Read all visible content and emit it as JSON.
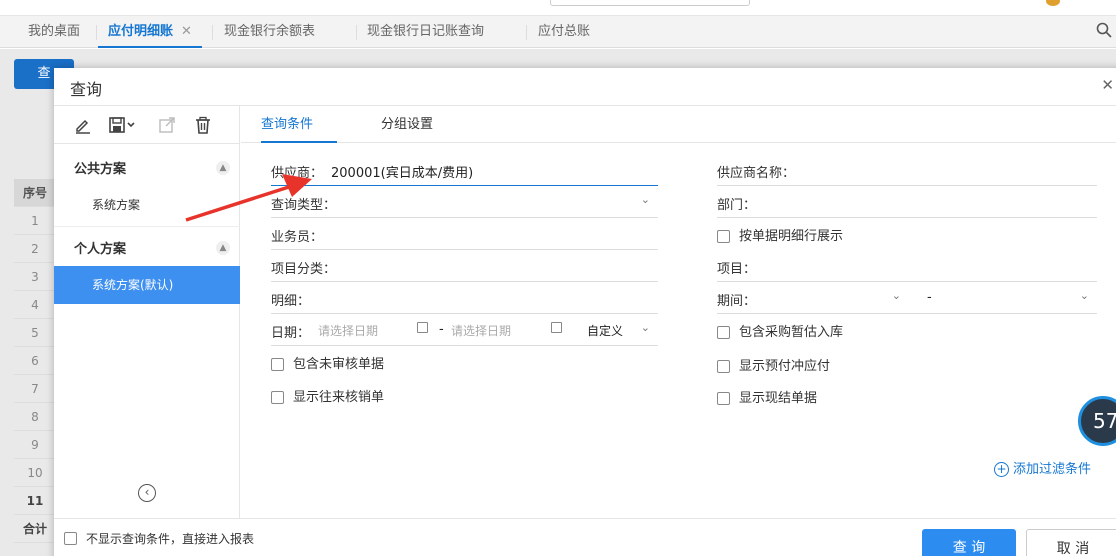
{
  "tabs": [
    {
      "label": "我的桌面"
    },
    {
      "label": "应付明细账",
      "close": "✕"
    },
    {
      "label": "现金银行余额表"
    },
    {
      "label": "现金银行日记账查询"
    },
    {
      "label": "应付总账"
    }
  ],
  "background": {
    "query_button": "查",
    "col_header": "序号",
    "rows": [
      "1",
      "2",
      "3",
      "4",
      "5",
      "6",
      "7",
      "8",
      "9",
      "10",
      "11"
    ],
    "total": "合计"
  },
  "dialog": {
    "title": "查询",
    "close": "✕"
  },
  "left": {
    "public_group": "公共方案",
    "public_item": "系统方案",
    "personal_group": "个人方案",
    "personal_item": "系统方案(默认)"
  },
  "query_tabs": {
    "conditions": "查询条件",
    "grouping": "分组设置"
  },
  "form": {
    "supplier_label": "供应商：",
    "supplier_value": "200001(宾日成本/费用)",
    "query_type_label": "查询类型：",
    "salesman_label": "业务员：",
    "project_category_label": "项目分类：",
    "detail_label": "明细：",
    "date_label": "日期：",
    "date_start_placeholder": "请选择日期",
    "date_sep": "-",
    "date_end_placeholder": "请选择日期",
    "date_mode": "自定义",
    "include_unaudited": "包含未审核单据",
    "show_writeoff": "显示往来核销单",
    "supplier_name_label": "供应商名称：",
    "department_label": "部门：",
    "show_by_detail": "按单据明细行展示",
    "project_label": "项目：",
    "period_label": "期间：",
    "period_sep": "-",
    "include_estimate": "包含采购暂估入库",
    "show_prepay": "显示预付冲应付",
    "show_settled": "显示现结单据",
    "add_filter": "添加过滤条件"
  },
  "footer": {
    "skip_label": "不显示查询条件，直接进入报表",
    "query_button": "查 询",
    "cancel_button": "取 消"
  },
  "badge": "57"
}
